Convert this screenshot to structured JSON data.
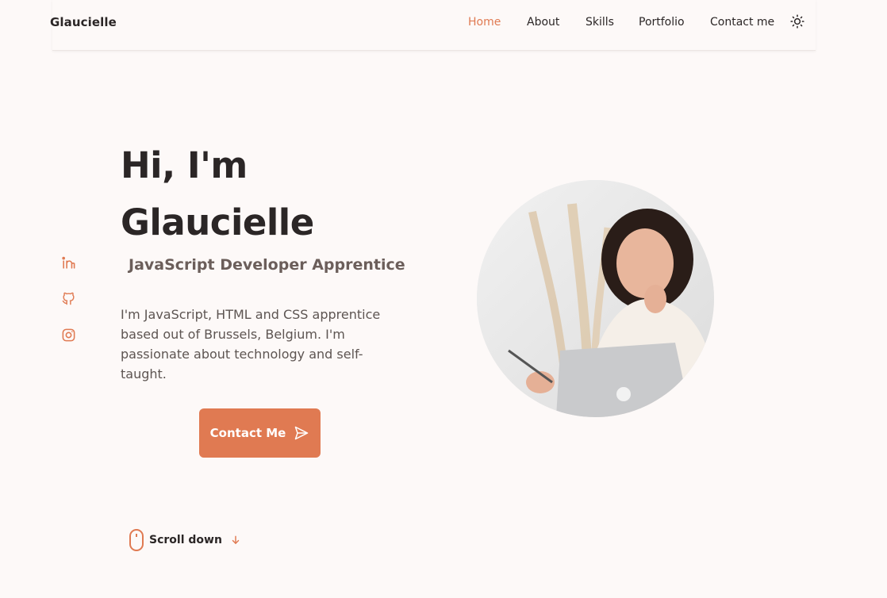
{
  "header": {
    "logo": "Glaucielle",
    "nav": [
      {
        "label": "Home",
        "active": true
      },
      {
        "label": "About",
        "active": false
      },
      {
        "label": "Skills",
        "active": false
      },
      {
        "label": "Portfolio",
        "active": false
      },
      {
        "label": "Contact me",
        "active": false
      }
    ],
    "theme_icon": "sun-icon"
  },
  "social": [
    "linkedin-icon",
    "github-icon",
    "instagram-icon"
  ],
  "hero": {
    "greeting": "Hi, I'm",
    "name": "Glaucielle",
    "subtitle": "JavaScript Developer Apprentice",
    "description": "I'm JavaScript, HTML and CSS apprentice based out of Brussels, Belgium. I'm passionate about technology and self-taught.",
    "cta_label": "Contact Me",
    "cta_icon": "send-icon"
  },
  "scroll": {
    "label": "Scroll down",
    "icon": "mouse-icon",
    "arrow": "arrow-down-icon"
  },
  "colors": {
    "accent": "#e07a52",
    "text": "#2b2626",
    "muted": "#6b5e5a",
    "background": "#fdf9f8"
  }
}
